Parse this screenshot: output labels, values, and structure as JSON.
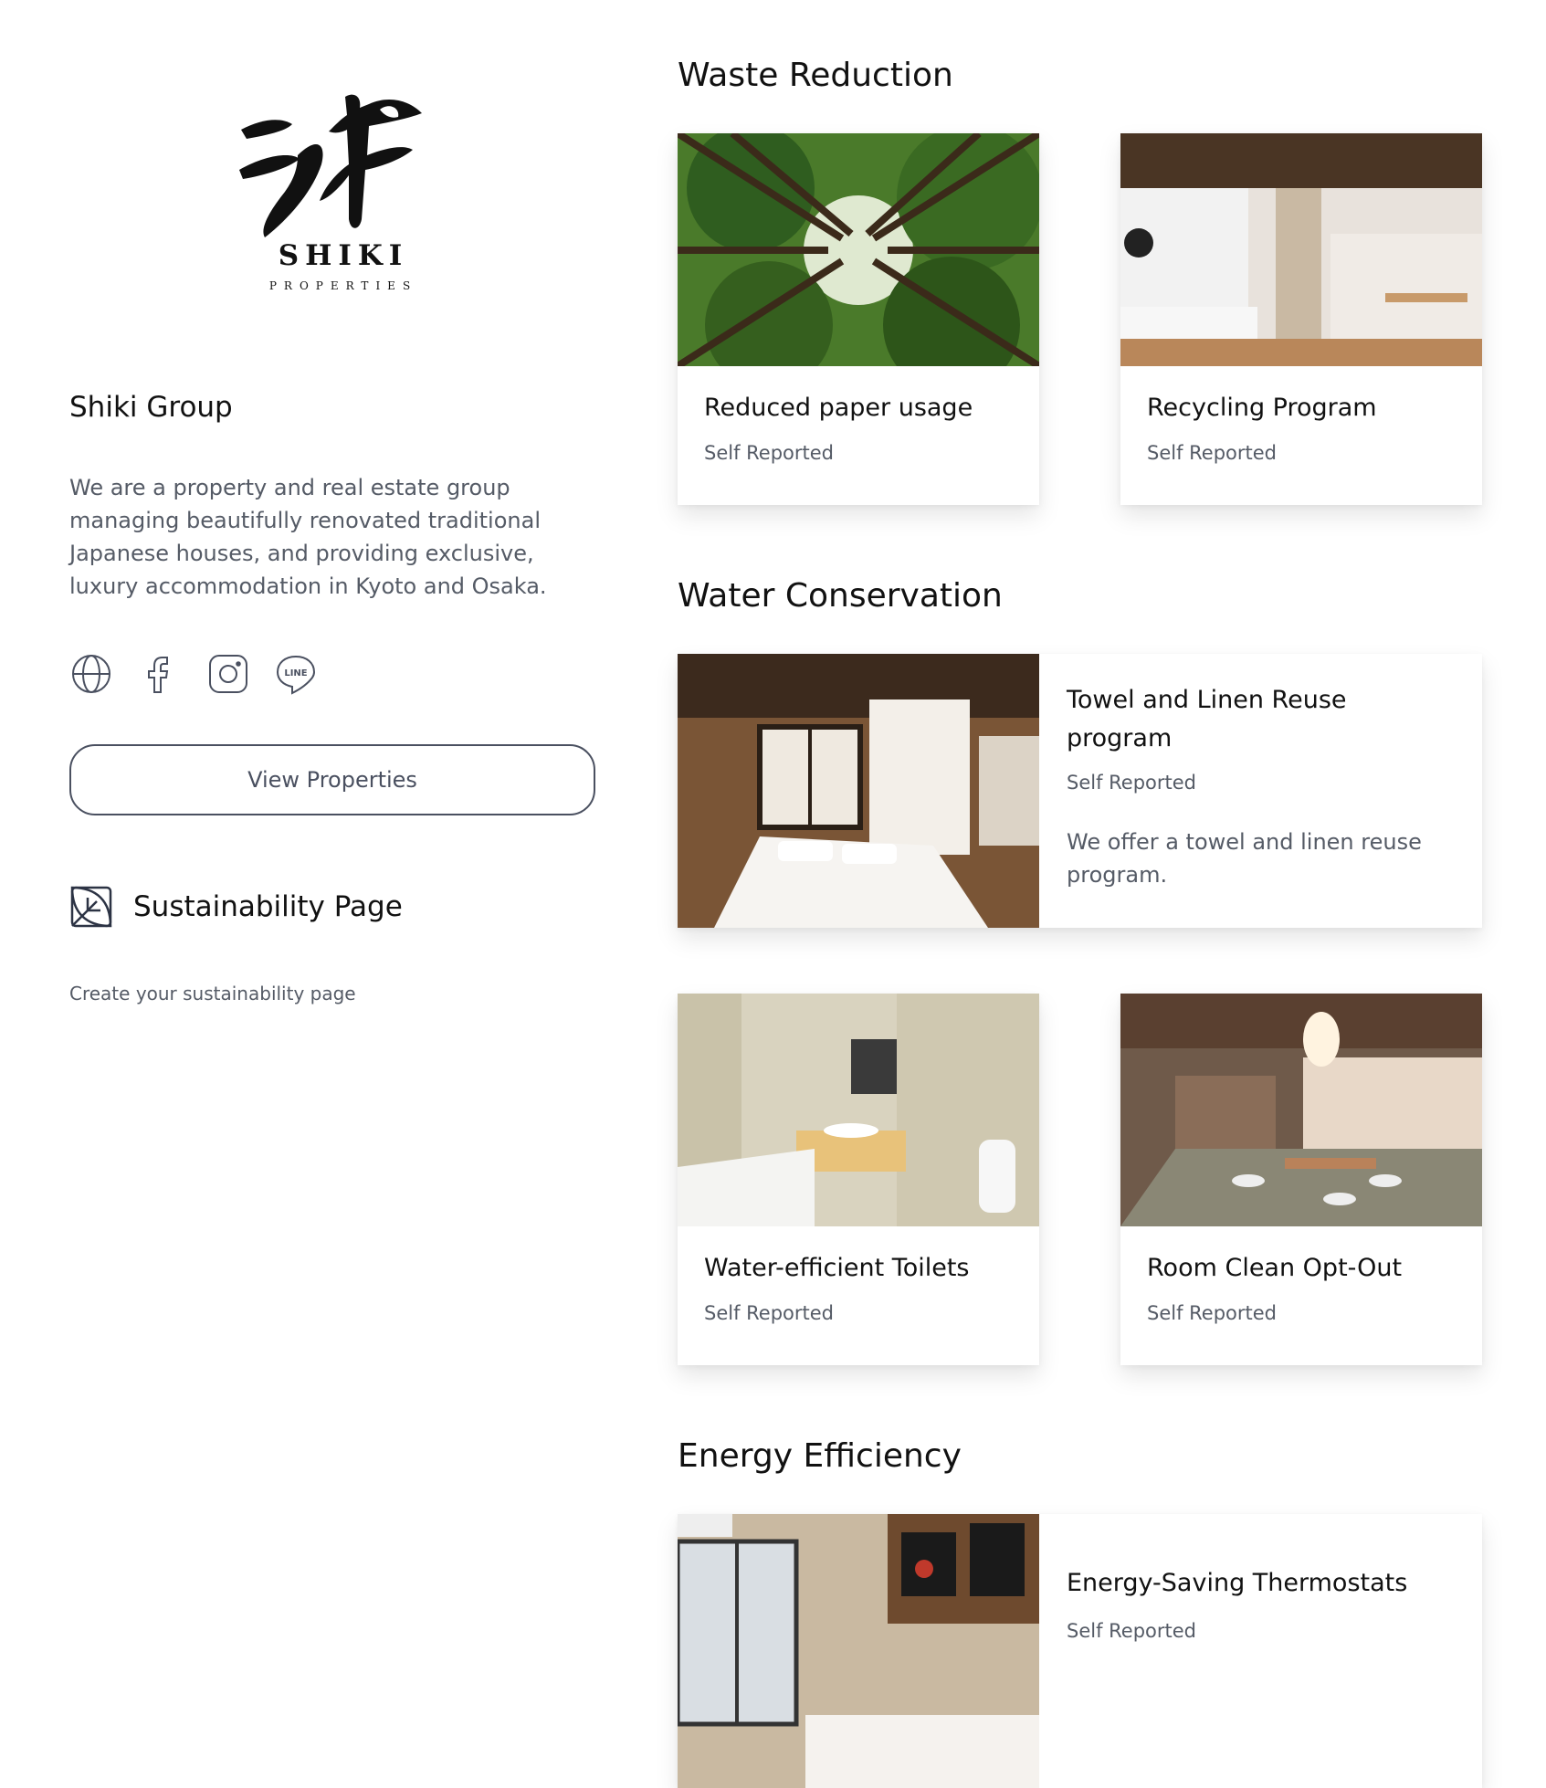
{
  "logo": {
    "name": "SHIKI",
    "sub": "PROPERTIES"
  },
  "org": {
    "name": "Shiki Group",
    "description": "We are a property and real estate group managing beautifully renovated traditional Japanese houses, and providing exclusive, luxury accommodation in Kyoto and Osaka."
  },
  "socials": [
    {
      "icon": "globe-icon"
    },
    {
      "icon": "facebook-icon"
    },
    {
      "icon": "instagram-icon"
    },
    {
      "icon": "line-icon",
      "text": "LINE"
    }
  ],
  "view_button": "View Properties",
  "sustainability": {
    "title": "Sustainability Page",
    "link": "Create your sustainability page",
    "icon": "leaf-icon"
  },
  "sections": {
    "waste": {
      "title": "Waste Reduction",
      "cards": [
        {
          "title": "Reduced paper usage",
          "sub": "Self Reported"
        },
        {
          "title": "Recycling Program",
          "sub": "Self Reported"
        }
      ]
    },
    "water": {
      "title": "Water Conservation",
      "featured": {
        "title": "Towel and Linen Reuse program",
        "sub": "Self Reported",
        "desc": "We offer a towel and linen reuse program."
      },
      "cards": [
        {
          "title": "Water-efficient Toilets",
          "sub": "Self Reported"
        },
        {
          "title": "Room Clean Opt-Out",
          "sub": "Self Reported"
        }
      ]
    },
    "energy": {
      "title": "Energy Efficiency",
      "featured": {
        "title": "Energy-Saving Thermostats",
        "sub": "Self Reported"
      }
    }
  },
  "colors": {
    "text": "#111111",
    "muted": "#555b66",
    "border": "#4a5060",
    "background": "#ffffff"
  }
}
